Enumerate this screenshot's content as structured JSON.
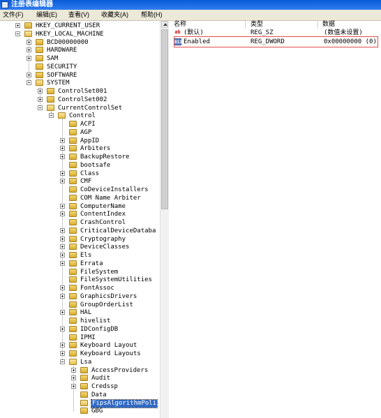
{
  "window": {
    "title": "注册表编辑器"
  },
  "menu": [
    "文件(F)",
    "编辑(E)",
    "查看(V)",
    "收藏夹(A)",
    "帮助(H)"
  ],
  "tree": [
    {
      "label": "HKEY_CURRENT_USER",
      "depth": 0,
      "exp": "plus"
    },
    {
      "label": "HKEY_LOCAL_MACHINE",
      "depth": 0,
      "exp": "minus"
    },
    {
      "label": "BCD00000000",
      "depth": 1,
      "exp": "plus"
    },
    {
      "label": "HARDWARE",
      "depth": 1,
      "exp": "plus"
    },
    {
      "label": "SAM",
      "depth": 1,
      "exp": "plus"
    },
    {
      "label": "SECURITY",
      "depth": 1,
      "exp": "none"
    },
    {
      "label": "SOFTWARE",
      "depth": 1,
      "exp": "plus"
    },
    {
      "label": "SYSTEM",
      "depth": 1,
      "exp": "minus"
    },
    {
      "label": "ControlSet001",
      "depth": 2,
      "exp": "plus"
    },
    {
      "label": "ControlSet002",
      "depth": 2,
      "exp": "plus"
    },
    {
      "label": "CurrentControlSet",
      "depth": 2,
      "exp": "minus"
    },
    {
      "label": "Control",
      "depth": 3,
      "exp": "minus"
    },
    {
      "label": "ACPI",
      "depth": 4,
      "exp": "none"
    },
    {
      "label": "AGP",
      "depth": 4,
      "exp": "none"
    },
    {
      "label": "AppID",
      "depth": 4,
      "exp": "plus"
    },
    {
      "label": "Arbiters",
      "depth": 4,
      "exp": "plus"
    },
    {
      "label": "BackupRestore",
      "depth": 4,
      "exp": "plus"
    },
    {
      "label": "bootsafe",
      "depth": 4,
      "exp": "none"
    },
    {
      "label": "Class",
      "depth": 4,
      "exp": "plus"
    },
    {
      "label": "CMF",
      "depth": 4,
      "exp": "plus"
    },
    {
      "label": "CoDeviceInstallers",
      "depth": 4,
      "exp": "none"
    },
    {
      "label": "COM Name Arbiter",
      "depth": 4,
      "exp": "none"
    },
    {
      "label": "ComputerName",
      "depth": 4,
      "exp": "plus"
    },
    {
      "label": "ContentIndex",
      "depth": 4,
      "exp": "plus"
    },
    {
      "label": "CrashControl",
      "depth": 4,
      "exp": "none"
    },
    {
      "label": "CriticalDeviceDataba",
      "depth": 4,
      "exp": "plus"
    },
    {
      "label": "Cryptography",
      "depth": 4,
      "exp": "plus"
    },
    {
      "label": "DeviceClasses",
      "depth": 4,
      "exp": "plus"
    },
    {
      "label": "Els",
      "depth": 4,
      "exp": "plus"
    },
    {
      "label": "Errata",
      "depth": 4,
      "exp": "plus"
    },
    {
      "label": "FileSystem",
      "depth": 4,
      "exp": "none"
    },
    {
      "label": "FileSystemUtilities",
      "depth": 4,
      "exp": "none"
    },
    {
      "label": "FontAssoc",
      "depth": 4,
      "exp": "plus"
    },
    {
      "label": "GraphicsDrivers",
      "depth": 4,
      "exp": "plus"
    },
    {
      "label": "GroupOrderList",
      "depth": 4,
      "exp": "none"
    },
    {
      "label": "HAL",
      "depth": 4,
      "exp": "plus"
    },
    {
      "label": "hivelist",
      "depth": 4,
      "exp": "none"
    },
    {
      "label": "IDConfigDB",
      "depth": 4,
      "exp": "plus"
    },
    {
      "label": "IPMI",
      "depth": 4,
      "exp": "none"
    },
    {
      "label": "Keyboard Layout",
      "depth": 4,
      "exp": "plus"
    },
    {
      "label": "Keyboard Layouts",
      "depth": 4,
      "exp": "plus"
    },
    {
      "label": "Lsa",
      "depth": 4,
      "exp": "minus"
    },
    {
      "label": "AccessProviders",
      "depth": 5,
      "exp": "plus"
    },
    {
      "label": "Audit",
      "depth": 5,
      "exp": "plus"
    },
    {
      "label": "Credssp",
      "depth": 5,
      "exp": "plus"
    },
    {
      "label": "Data",
      "depth": 5,
      "exp": "none"
    },
    {
      "label": "FipsAlgorithmPoli",
      "depth": 5,
      "exp": "none",
      "selected": true
    },
    {
      "label": "GBG",
      "depth": 5,
      "exp": "none"
    }
  ],
  "list": {
    "headers": [
      "名称",
      "类型",
      "数据"
    ],
    "rows": [
      {
        "icon": "string-value-icon",
        "glyph": "ab",
        "name": "(默认)",
        "type": "REG_SZ",
        "data": "(数值未设置)"
      },
      {
        "icon": "dword-value-icon",
        "glyph": "011",
        "name": "Enabled",
        "type": "REG_DWORD",
        "data": "0x00000000 (0)"
      }
    ]
  },
  "colors": {
    "selection": "#316ac5",
    "highlight_box": "#e34b4b",
    "titlebar": "#0a5bd8"
  }
}
